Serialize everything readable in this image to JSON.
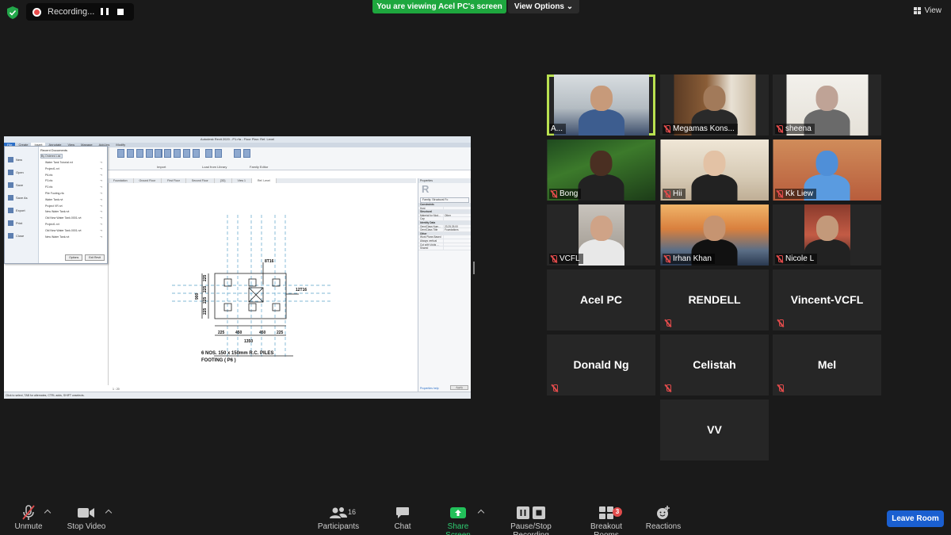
{
  "top": {
    "recording_label": "Recording...",
    "viewing_banner": "You are viewing Acel PC's screen",
    "view_options": "View Options",
    "view": "View",
    "colors": {
      "banner": "#1ea73e",
      "active_speaker": "#b9e150",
      "leave": "#1a5fd0"
    }
  },
  "shared": {
    "app_title": "Autodesk Revit 2020 - P1.rfa - Floor Plan: Ref. Level",
    "ribbon_tabs": [
      "File",
      "Create",
      "Insert",
      "Annotate",
      "View",
      "Manage",
      "Add-Ins",
      "Modify"
    ],
    "ribbon_groups": [
      "Import",
      "Load from Library",
      "Family Editor"
    ],
    "file_menu": {
      "left_items": [
        "New",
        "Open",
        "Save",
        "Save As",
        "Export",
        "Print",
        "Close"
      ],
      "recent_header": "Recent Documents",
      "sort": "By Ordered List",
      "recent": [
        "Water Tank Tutorial.rvt",
        "Project1.rvt",
        "P6.rfa",
        "P3.rfa",
        "P2.rfa",
        "Pile Footing.rfa",
        "Water Tank.rvt",
        "Project VR.rvt",
        "New Water Tank.rvt",
        "Old New Water Tank.0001.rvt",
        "Project1.rvt",
        "Old New Water Tank.0001.rvt",
        "New Water Tank.rvt"
      ],
      "options_btn": "Options",
      "exit_btn": "Exit Revit"
    },
    "view_tabs": [
      "Foundation",
      "Ground Floor",
      "First Floor",
      "Second Floor",
      "{3D}",
      "View 1",
      "Ref. Level"
    ],
    "drawing": {
      "bar_top": "8T16",
      "bar_right": "12T16",
      "dims_vertical": [
        "225",
        "225",
        "225",
        "225"
      ],
      "dim_total_vertical": "900",
      "dims_horizontal": [
        "225",
        "450",
        "450",
        "225"
      ],
      "dim_total_horizontal": "1350",
      "caption_line1": "6 NOS. 150 x 150mm R.C. PILES",
      "caption_line2": "FOOTING ( P6 )"
    },
    "properties": {
      "title": "Properties",
      "type": "Family: Structural Fo",
      "rows": [
        [
          "Constraints",
          ""
        ],
        [
          "Host",
          ""
        ],
        [
          "Structural",
          ""
        ],
        [
          "Material for Mod...",
          "Other"
        ],
        [
          "Cap",
          ""
        ],
        [
          "Identity Data",
          ""
        ],
        [
          "OmniClass Num...",
          "23.25.25.00"
        ],
        [
          "OmniClass Title",
          "Foundations"
        ],
        [
          "Other",
          ""
        ],
        [
          "Work Plane-Based",
          ""
        ],
        [
          "Always vertical",
          ""
        ],
        [
          "Cut with Voids ...",
          ""
        ],
        [
          "Shared",
          ""
        ]
      ],
      "help": "Properties help",
      "apply": "Apply"
    },
    "scale": "1 : 20",
    "status": "Click to select, TAB for alternates, CTRL adds, SHIFT unselects."
  },
  "participants": [
    {
      "name": "A...",
      "kind": "video",
      "active": true,
      "muted": false
    },
    {
      "name": "Megamas Kons...",
      "kind": "video",
      "muted": true
    },
    {
      "name": "sheena",
      "kind": "video",
      "muted": true
    },
    {
      "name": "Bong",
      "kind": "video",
      "muted": true
    },
    {
      "name": "Hii",
      "kind": "video",
      "muted": true
    },
    {
      "name": "Kk Liew",
      "kind": "video",
      "muted": true
    },
    {
      "name": "VCFL",
      "kind": "video",
      "muted": true
    },
    {
      "name": "Irhan Khan",
      "kind": "video",
      "muted": true
    },
    {
      "name": "Nicole L",
      "kind": "video",
      "muted": true
    },
    {
      "name": "Acel PC",
      "kind": "name",
      "muted": false
    },
    {
      "name": "RENDELL",
      "kind": "name",
      "muted": true
    },
    {
      "name": "Vincent-VCFL",
      "kind": "name",
      "muted": true
    },
    {
      "name": "Donald Ng",
      "kind": "name",
      "muted": true
    },
    {
      "name": "Celistah",
      "kind": "name",
      "muted": true
    },
    {
      "name": "Mel",
      "kind": "name",
      "muted": true
    },
    {
      "name": "VV",
      "kind": "name",
      "muted": false
    }
  ],
  "toolbar": {
    "unmute": "Unmute",
    "stop_video": "Stop Video",
    "participants": "Participants",
    "participants_count": "16",
    "chat": "Chat",
    "share_screen": "Share Screen",
    "pause_stop_recording": "Pause/Stop Recording",
    "breakout_rooms": "Breakout Rooms",
    "breakout_badge": "3",
    "reactions": "Reactions",
    "leave_room": "Leave Room"
  }
}
